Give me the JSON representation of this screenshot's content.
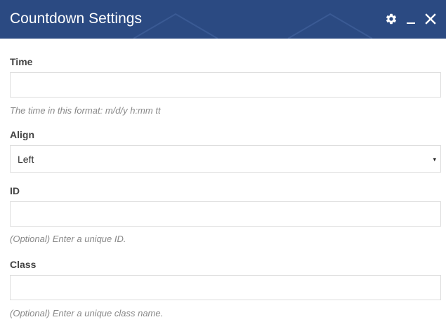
{
  "dialog": {
    "title": "Countdown Settings",
    "header_color": "#2b4a82",
    "icons": {
      "settings": "gear-icon",
      "minimize": "minimize-icon",
      "close": "close-icon"
    }
  },
  "fields": {
    "time": {
      "label": "Time",
      "value": "",
      "hint": "The time in this format: m/d/y h:mm tt"
    },
    "align": {
      "label": "Align",
      "selected": "Left",
      "arrow": "▾"
    },
    "id": {
      "label": "ID",
      "value": "",
      "hint": "(Optional) Enter a unique ID."
    },
    "class": {
      "label": "Class",
      "value": "",
      "hint": "(Optional) Enter a unique class name."
    }
  }
}
